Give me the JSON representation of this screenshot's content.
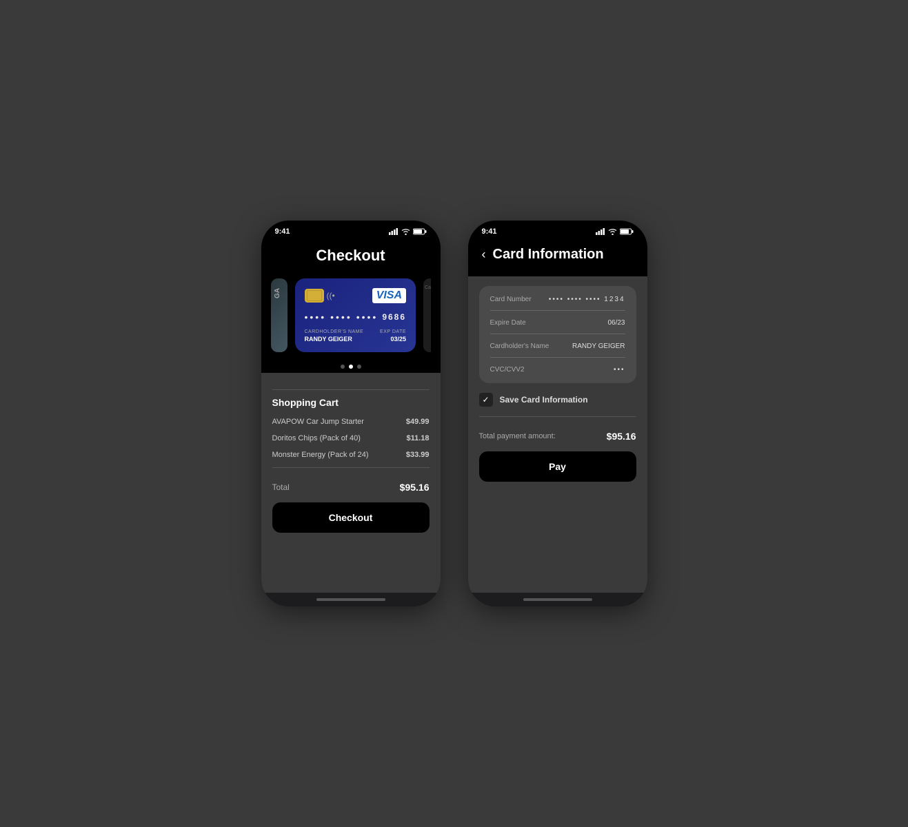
{
  "phone1": {
    "status_bar": {
      "time": "9:41",
      "icons": "signal wifi battery"
    },
    "header": {
      "title": "Checkout"
    },
    "card": {
      "number_dots": "•••• •••• •••• 9686",
      "last4": "9686",
      "cardholder_label": "Cardholder's Name",
      "cardholder": "RANDY GEIGER",
      "exp_label": "EXP DATE",
      "exp": "03/25",
      "brand": "VISA"
    },
    "carousel_dots": [
      "inactive",
      "active",
      "inactive"
    ],
    "shopping_cart": {
      "title": "Shopping Cart",
      "items": [
        {
          "name": "AVAPOW Car Jump Starter",
          "price": "$49.99"
        },
        {
          "name": "Doritos Chips (Pack of 40)",
          "price": "$11.18"
        },
        {
          "name": "Monster Energy (Pack of 24)",
          "price": "$33.99"
        }
      ],
      "total_label": "Total",
      "total_value": "$95.16",
      "checkout_button": "Checkout"
    }
  },
  "phone2": {
    "status_bar": {
      "time": "9:41",
      "icons": "signal wifi battery"
    },
    "header": {
      "back_label": "‹",
      "title": "Card Information"
    },
    "form": {
      "fields": [
        {
          "label": "Card Number",
          "value": "•••• •••• •••• 1234",
          "type": "masked"
        },
        {
          "label": "Expire Date",
          "value": "06/23",
          "type": "text"
        },
        {
          "label": "Cardholder's Name",
          "value": "RANDY GEIGER",
          "type": "text"
        },
        {
          "label": "CVC/CVV2",
          "value": "•••",
          "type": "masked"
        }
      ]
    },
    "save_card": {
      "label": "Save Card Information",
      "checked": true
    },
    "payment": {
      "label": "Total payment amount:",
      "value": "$95.16"
    },
    "pay_button": "Pay"
  }
}
